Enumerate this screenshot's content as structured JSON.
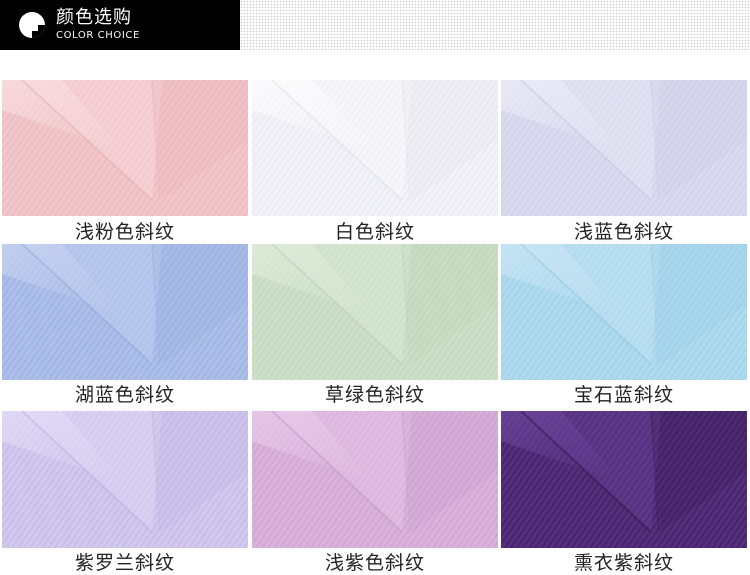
{
  "header": {
    "title": "颜色选购",
    "subtitle": "COLOR  CHOICE"
  },
  "swatches": [
    {
      "label": "浅粉色斜纹",
      "color": "#f1c7cb",
      "light": "#fbe3e4",
      "dark": "#e2aab0"
    },
    {
      "label": "白色斜纹",
      "color": "#f3f2f8",
      "light": "#ffffff",
      "dark": "#dcdbe6"
    },
    {
      "label": "浅蓝色斜纹",
      "color": "#dbdbef",
      "light": "#efeffa",
      "dark": "#c3c3df"
    },
    {
      "label": "湖蓝色斜纹",
      "color": "#aebfe8",
      "light": "#cbd6f3",
      "dark": "#8ea4db"
    },
    {
      "label": "草绿色斜纹",
      "color": "#cee0c9",
      "light": "#e3eedf",
      "dark": "#b5cdb0"
    },
    {
      "label": "宝石蓝斜纹",
      "color": "#b0daee",
      "light": "#cfe9f6",
      "dark": "#8dc5e2"
    },
    {
      "label": "紫罗兰斜纹",
      "color": "#d3c8ee",
      "light": "#e7e0f8",
      "dark": "#b9aade"
    },
    {
      "label": "浅紫色斜纹",
      "color": "#dab3dc",
      "light": "#ebcfec",
      "dark": "#c293c6"
    },
    {
      "label": "熏衣紫斜纹",
      "color": "#55307f",
      "light": "#6f49a0",
      "dark": "#2a1540"
    }
  ]
}
